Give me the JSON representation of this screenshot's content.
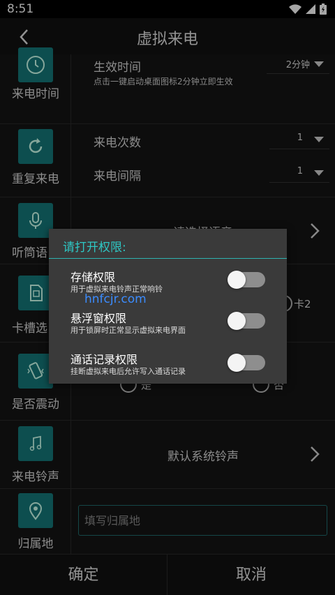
{
  "status_bar": {
    "time": "8:51"
  },
  "app_bar": {
    "title": "虚拟来电"
  },
  "rows": {
    "effective": {
      "label": "来电时间",
      "title": "生效时间",
      "hint": "点击一键启动桌面图标2分钟立即生效",
      "value": "2分钟"
    },
    "repeat": {
      "label": "重复来电",
      "count_label": "来电次数",
      "count_value": "1",
      "interval_label": "来电间隔",
      "interval_value": "1"
    },
    "voice": {
      "label": "听筒语",
      "value": "请选择语音"
    },
    "sim": {
      "label": "卡槽选",
      "option2": "卡2"
    },
    "vibrate": {
      "label": "是否震动",
      "yes": "是",
      "no": "否"
    },
    "ringtone": {
      "label": "来电铃声",
      "value": "默认系统铃声"
    },
    "location": {
      "label": "归属地",
      "placeholder": "填写归属地"
    }
  },
  "bottom": {
    "confirm": "确定",
    "cancel": "取消"
  },
  "dialog": {
    "title": "请打开权限:",
    "permissions": [
      {
        "title": "存储权限",
        "desc": "用于虚拟来电铃声正常响铃",
        "enabled": false
      },
      {
        "title": "悬浮窗权限",
        "desc": "用于锁屏时正常显示虚拟来电界面",
        "enabled": false
      },
      {
        "title": "通话记录权限",
        "desc": "挂断虚拟来电后允许写入通话记录",
        "enabled": false
      }
    ]
  },
  "watermark": "hnfcjr.com",
  "colors": {
    "accent": "#14797a",
    "dialog_accent": "#2ec7c4",
    "background": "#141414"
  }
}
